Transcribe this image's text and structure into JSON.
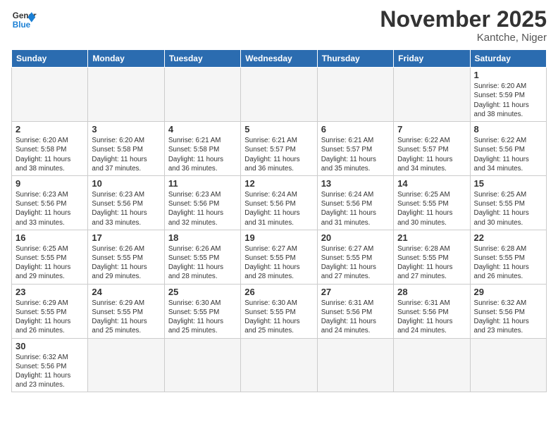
{
  "header": {
    "logo_general": "General",
    "logo_blue": "Blue",
    "month_title": "November 2025",
    "location": "Kantche, Niger"
  },
  "days_of_week": [
    "Sunday",
    "Monday",
    "Tuesday",
    "Wednesday",
    "Thursday",
    "Friday",
    "Saturday"
  ],
  "weeks": [
    [
      {
        "day": "",
        "info": ""
      },
      {
        "day": "",
        "info": ""
      },
      {
        "day": "",
        "info": ""
      },
      {
        "day": "",
        "info": ""
      },
      {
        "day": "",
        "info": ""
      },
      {
        "day": "",
        "info": ""
      },
      {
        "day": "1",
        "info": "Sunrise: 6:20 AM\nSunset: 5:59 PM\nDaylight: 11 hours\nand 38 minutes."
      }
    ],
    [
      {
        "day": "2",
        "info": "Sunrise: 6:20 AM\nSunset: 5:58 PM\nDaylight: 11 hours\nand 38 minutes."
      },
      {
        "day": "3",
        "info": "Sunrise: 6:20 AM\nSunset: 5:58 PM\nDaylight: 11 hours\nand 37 minutes."
      },
      {
        "day": "4",
        "info": "Sunrise: 6:21 AM\nSunset: 5:58 PM\nDaylight: 11 hours\nand 36 minutes."
      },
      {
        "day": "5",
        "info": "Sunrise: 6:21 AM\nSunset: 5:57 PM\nDaylight: 11 hours\nand 36 minutes."
      },
      {
        "day": "6",
        "info": "Sunrise: 6:21 AM\nSunset: 5:57 PM\nDaylight: 11 hours\nand 35 minutes."
      },
      {
        "day": "7",
        "info": "Sunrise: 6:22 AM\nSunset: 5:57 PM\nDaylight: 11 hours\nand 34 minutes."
      },
      {
        "day": "8",
        "info": "Sunrise: 6:22 AM\nSunset: 5:56 PM\nDaylight: 11 hours\nand 34 minutes."
      }
    ],
    [
      {
        "day": "9",
        "info": "Sunrise: 6:23 AM\nSunset: 5:56 PM\nDaylight: 11 hours\nand 33 minutes."
      },
      {
        "day": "10",
        "info": "Sunrise: 6:23 AM\nSunset: 5:56 PM\nDaylight: 11 hours\nand 33 minutes."
      },
      {
        "day": "11",
        "info": "Sunrise: 6:23 AM\nSunset: 5:56 PM\nDaylight: 11 hours\nand 32 minutes."
      },
      {
        "day": "12",
        "info": "Sunrise: 6:24 AM\nSunset: 5:56 PM\nDaylight: 11 hours\nand 31 minutes."
      },
      {
        "day": "13",
        "info": "Sunrise: 6:24 AM\nSunset: 5:56 PM\nDaylight: 11 hours\nand 31 minutes."
      },
      {
        "day": "14",
        "info": "Sunrise: 6:25 AM\nSunset: 5:55 PM\nDaylight: 11 hours\nand 30 minutes."
      },
      {
        "day": "15",
        "info": "Sunrise: 6:25 AM\nSunset: 5:55 PM\nDaylight: 11 hours\nand 30 minutes."
      }
    ],
    [
      {
        "day": "16",
        "info": "Sunrise: 6:25 AM\nSunset: 5:55 PM\nDaylight: 11 hours\nand 29 minutes."
      },
      {
        "day": "17",
        "info": "Sunrise: 6:26 AM\nSunset: 5:55 PM\nDaylight: 11 hours\nand 29 minutes."
      },
      {
        "day": "18",
        "info": "Sunrise: 6:26 AM\nSunset: 5:55 PM\nDaylight: 11 hours\nand 28 minutes."
      },
      {
        "day": "19",
        "info": "Sunrise: 6:27 AM\nSunset: 5:55 PM\nDaylight: 11 hours\nand 28 minutes."
      },
      {
        "day": "20",
        "info": "Sunrise: 6:27 AM\nSunset: 5:55 PM\nDaylight: 11 hours\nand 27 minutes."
      },
      {
        "day": "21",
        "info": "Sunrise: 6:28 AM\nSunset: 5:55 PM\nDaylight: 11 hours\nand 27 minutes."
      },
      {
        "day": "22",
        "info": "Sunrise: 6:28 AM\nSunset: 5:55 PM\nDaylight: 11 hours\nand 26 minutes."
      }
    ],
    [
      {
        "day": "23",
        "info": "Sunrise: 6:29 AM\nSunset: 5:55 PM\nDaylight: 11 hours\nand 26 minutes."
      },
      {
        "day": "24",
        "info": "Sunrise: 6:29 AM\nSunset: 5:55 PM\nDaylight: 11 hours\nand 25 minutes."
      },
      {
        "day": "25",
        "info": "Sunrise: 6:30 AM\nSunset: 5:55 PM\nDaylight: 11 hours\nand 25 minutes."
      },
      {
        "day": "26",
        "info": "Sunrise: 6:30 AM\nSunset: 5:55 PM\nDaylight: 11 hours\nand 25 minutes."
      },
      {
        "day": "27",
        "info": "Sunrise: 6:31 AM\nSunset: 5:56 PM\nDaylight: 11 hours\nand 24 minutes."
      },
      {
        "day": "28",
        "info": "Sunrise: 6:31 AM\nSunset: 5:56 PM\nDaylight: 11 hours\nand 24 minutes."
      },
      {
        "day": "29",
        "info": "Sunrise: 6:32 AM\nSunset: 5:56 PM\nDaylight: 11 hours\nand 23 minutes."
      }
    ],
    [
      {
        "day": "30",
        "info": "Sunrise: 6:32 AM\nSunset: 5:56 PM\nDaylight: 11 hours\nand 23 minutes."
      },
      {
        "day": "",
        "info": ""
      },
      {
        "day": "",
        "info": ""
      },
      {
        "day": "",
        "info": ""
      },
      {
        "day": "",
        "info": ""
      },
      {
        "day": "",
        "info": ""
      },
      {
        "day": "",
        "info": ""
      }
    ]
  ]
}
